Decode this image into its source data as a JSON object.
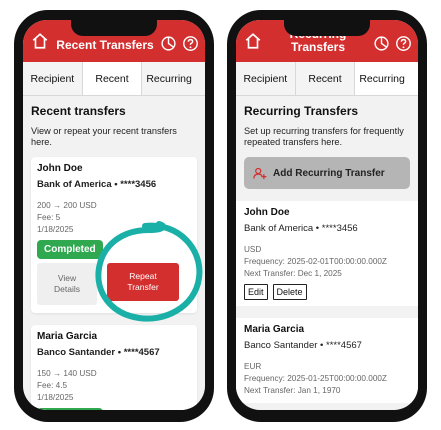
{
  "left": {
    "header": {
      "title": "Recent Transfers"
    },
    "tabs": [
      {
        "label": "Recipient"
      },
      {
        "label": "Recent"
      },
      {
        "label": "Recurring"
      }
    ],
    "section_title": "Recent transfers",
    "section_desc": "View or repeat your recent transfers here.",
    "cards": [
      {
        "name": "John Doe",
        "bank": "Bank of America • ****3456",
        "amount": "200 → 200 USD",
        "fee": "Fee: 5",
        "date": "1/18/2025",
        "status": "Completed",
        "view_label": "View Details",
        "repeat_label": "Repeat Transfer"
      },
      {
        "name": "Maria Garcia",
        "bank": "Banco Santander • ****4567",
        "amount": "150 → 140 USD",
        "fee": "Fee: 4.5",
        "date": "1/18/2025"
      }
    ]
  },
  "right": {
    "header": {
      "title": "Recurring Transfers"
    },
    "tabs": [
      {
        "label": "Recipient"
      },
      {
        "label": "Recent"
      },
      {
        "label": "Recurring"
      }
    ],
    "section_title": "Recurring Transfers",
    "section_desc": "Set up recurring transfers for frequently repeated transfers here.",
    "add_label": "Add Recurring Transfer",
    "items": [
      {
        "name": "John Doe",
        "bank": "Bank of America • ****3456",
        "currency": "USD",
        "frequency": "Frequency: 2025-02-01T00:00:00.000Z",
        "next": "Next Transfer: Dec 1, 2025",
        "edit_label": "Edit",
        "delete_label": "Delete"
      },
      {
        "name": "Maria Garcia",
        "bank": "Banco Santander • ****4567",
        "currency": "EUR",
        "frequency": "Frequency: 2025-01-25T00:00:00.000Z",
        "next": "Next Transfer: Jan 1, 1970"
      }
    ]
  },
  "colors": {
    "brand": "#d32f2f",
    "success": "#2fa84f",
    "annotation": "#1ab0a8"
  }
}
